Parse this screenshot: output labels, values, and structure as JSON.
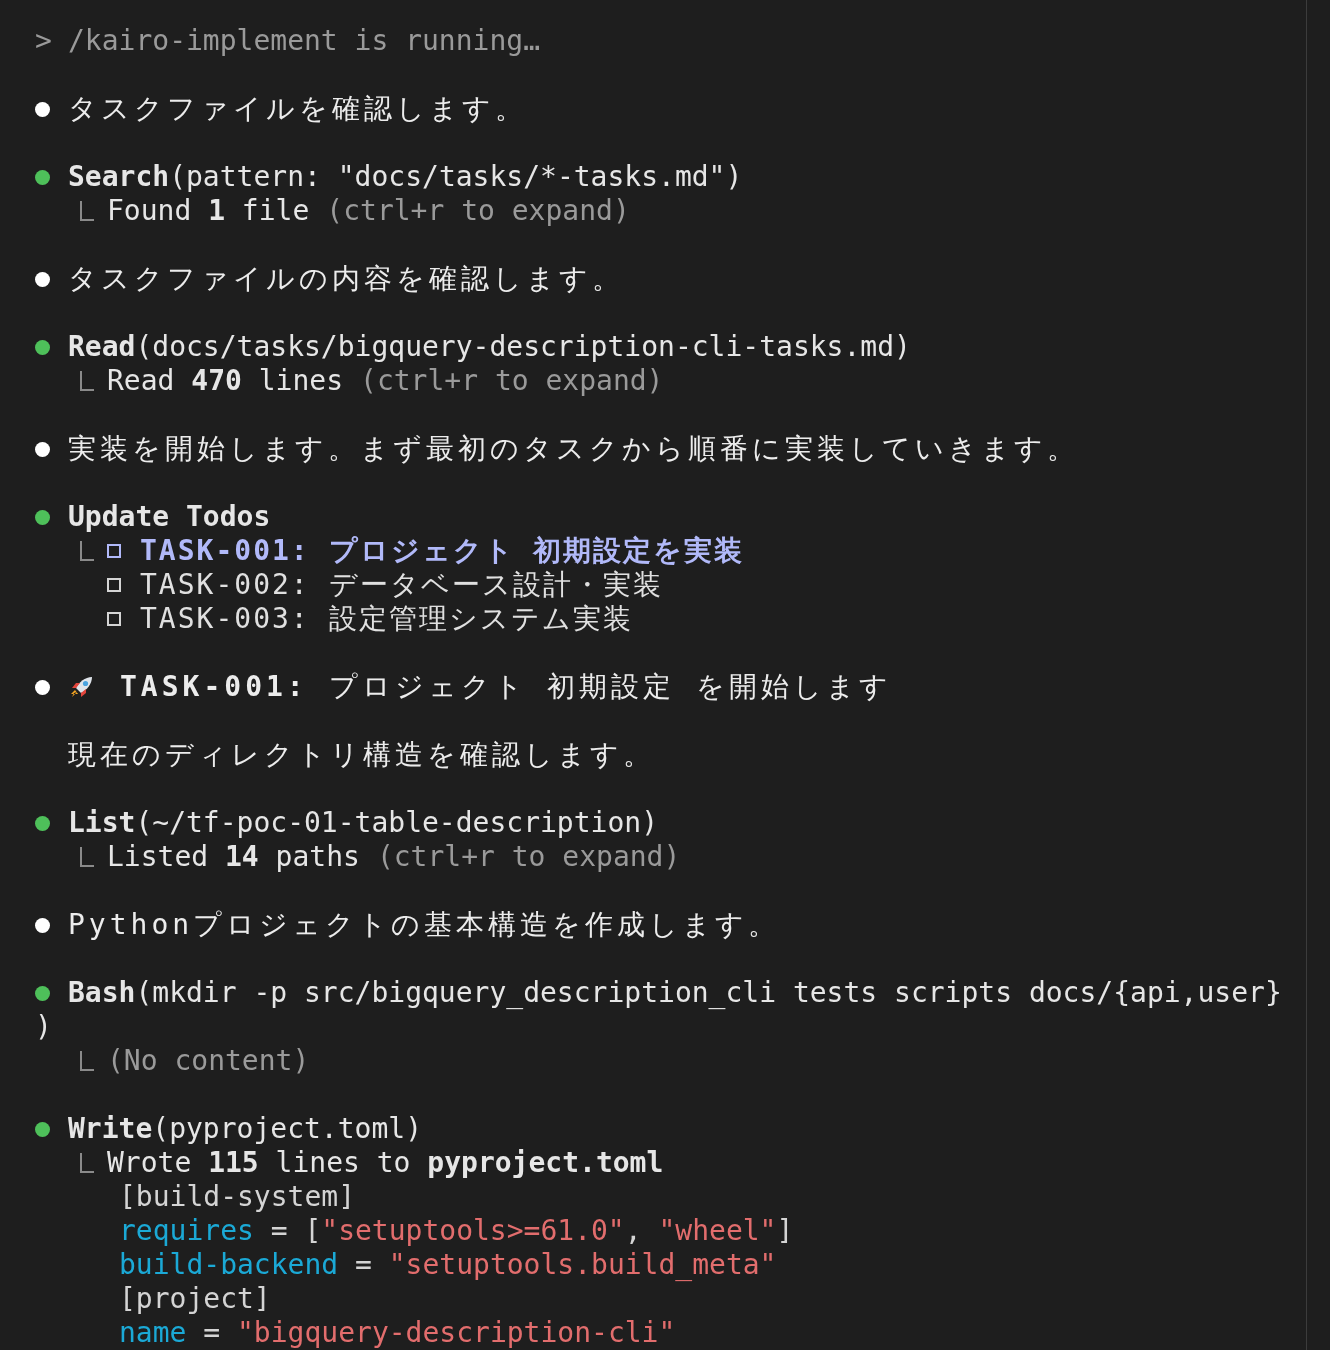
{
  "header": {
    "prompt": ">",
    "command": "/kairo-implement is running…"
  },
  "entries": [
    {
      "kind": "message",
      "color": "#ffffff",
      "text": "タスクファイルを確認します。"
    },
    {
      "kind": "tool",
      "color": "#4ec05a",
      "tool": "Search",
      "args": "(pattern: \"docs/tasks/*-tasks.md\")",
      "result": {
        "text": "Found **1** file",
        "dim": false,
        "hint": "(ctrl+r to expand)"
      }
    },
    {
      "kind": "message",
      "color": "#ffffff",
      "text": "タスクファイルの内容を確認します。"
    },
    {
      "kind": "tool",
      "color": "#4ec05a",
      "tool": "Read",
      "args": "(docs/tasks/bigquery-description-cli-tasks.md)",
      "result": {
        "text": "Read **470** lines",
        "dim": false,
        "hint": "(ctrl+r to expand)"
      }
    },
    {
      "kind": "message",
      "color": "#ffffff",
      "text": "実装を開始します。まず最初のタスクから順番に実装していきます。"
    },
    {
      "kind": "todos",
      "color": "#4ec05a",
      "tool": "Update Todos",
      "todos": [
        {
          "text": "TASK-001: プロジェクト 初期設定を実装",
          "checked": false,
          "in_progress": true
        },
        {
          "text": "TASK-002: データベース設計・実装",
          "checked": false,
          "in_progress": false
        },
        {
          "text": "TASK-003: 設定管理システム実装",
          "checked": false,
          "in_progress": false
        }
      ]
    },
    {
      "kind": "message",
      "color": "#ffffff",
      "rocket": true,
      "text": "**TASK-001:** プロジェクト 初期設定 を開始します",
      "extra": "現在のディレクトリ構造を確認します。"
    },
    {
      "kind": "tool",
      "color": "#4ec05a",
      "tool": "List",
      "args": "(~/tf-poc-01-table-description)",
      "result": {
        "text": "Listed **14** paths",
        "dim": false,
        "hint": "(ctrl+r to expand)"
      }
    },
    {
      "kind": "message",
      "color": "#ffffff",
      "text": "Pythonプロジェクトの基本構造を作成します。"
    },
    {
      "kind": "tool",
      "color": "#4ec05a",
      "tool": "Bash",
      "args": "(mkdir -p src/bigquery_description_cli tests scripts docs/{api,user}",
      "args_wrap": ")",
      "result": {
        "text": "(No content)",
        "dim": true
      }
    },
    {
      "kind": "tool",
      "color": "#4ec05a",
      "tool": "Write",
      "args": "(pyproject.toml)",
      "result": {
        "text": "Wrote **115** lines to **pyproject.toml**",
        "dim": false
      },
      "code": [
        [
          {
            "kind": "plain",
            "t": "[build-system]"
          }
        ],
        [
          {
            "kind": "key",
            "t": "requires"
          },
          {
            "kind": "plain",
            "t": " = ["
          },
          {
            "kind": "string",
            "t": "\"setuptools>=61.0\""
          },
          {
            "kind": "plain",
            "t": ", "
          },
          {
            "kind": "string",
            "t": "\"wheel\""
          },
          {
            "kind": "plain",
            "t": "]"
          }
        ],
        [
          {
            "kind": "key",
            "t": "build-backend"
          },
          {
            "kind": "plain",
            "t": " = "
          },
          {
            "kind": "string",
            "t": "\"setuptools.build_meta\""
          }
        ],
        [
          {
            "kind": "plain",
            "t": "[project]"
          }
        ],
        [
          {
            "kind": "key",
            "t": "name"
          },
          {
            "kind": "plain",
            "t": " = "
          },
          {
            "kind": "string",
            "t": "\"bigquery-description-cli\""
          }
        ]
      ]
    }
  ]
}
